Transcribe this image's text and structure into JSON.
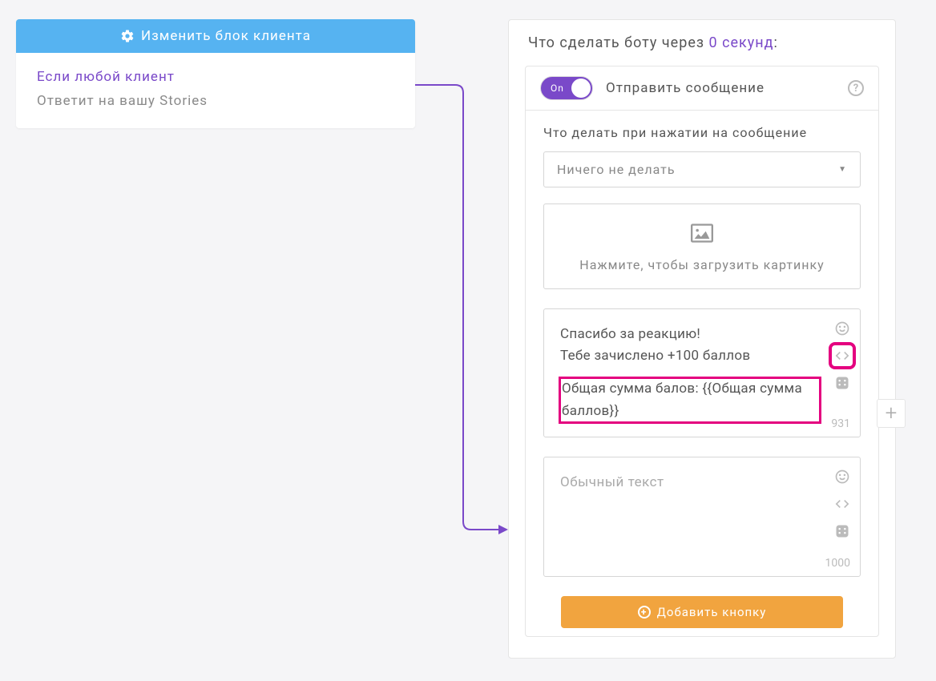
{
  "client_block": {
    "header_label": "Изменить блок клиента",
    "condition_line": "Если любой клиент",
    "trigger_line": "Ответит на вашу Stories"
  },
  "bot_block": {
    "title_prefix": "Что сделать боту через ",
    "delay_text": "0 секунд",
    "title_suffix": ":",
    "action": {
      "toggle_label": "On",
      "title": "Отправить сообщение",
      "click_section_label": "Что делать при нажатии на сообщение",
      "click_select_value": "Ничего не делать",
      "upload_text": "Нажмите, чтобы загрузить картинку",
      "message1": {
        "line1": "Спасибо за реакцию!",
        "line2": "Тебе зачислено +100 баллов",
        "line3": "Общая сумма балов:  {{Общая сумма баллов}}",
        "char_count": "931"
      },
      "message2": {
        "placeholder": "Обычный текст",
        "char_count": "1000"
      },
      "add_button_label": "Добавить кнопку"
    }
  }
}
